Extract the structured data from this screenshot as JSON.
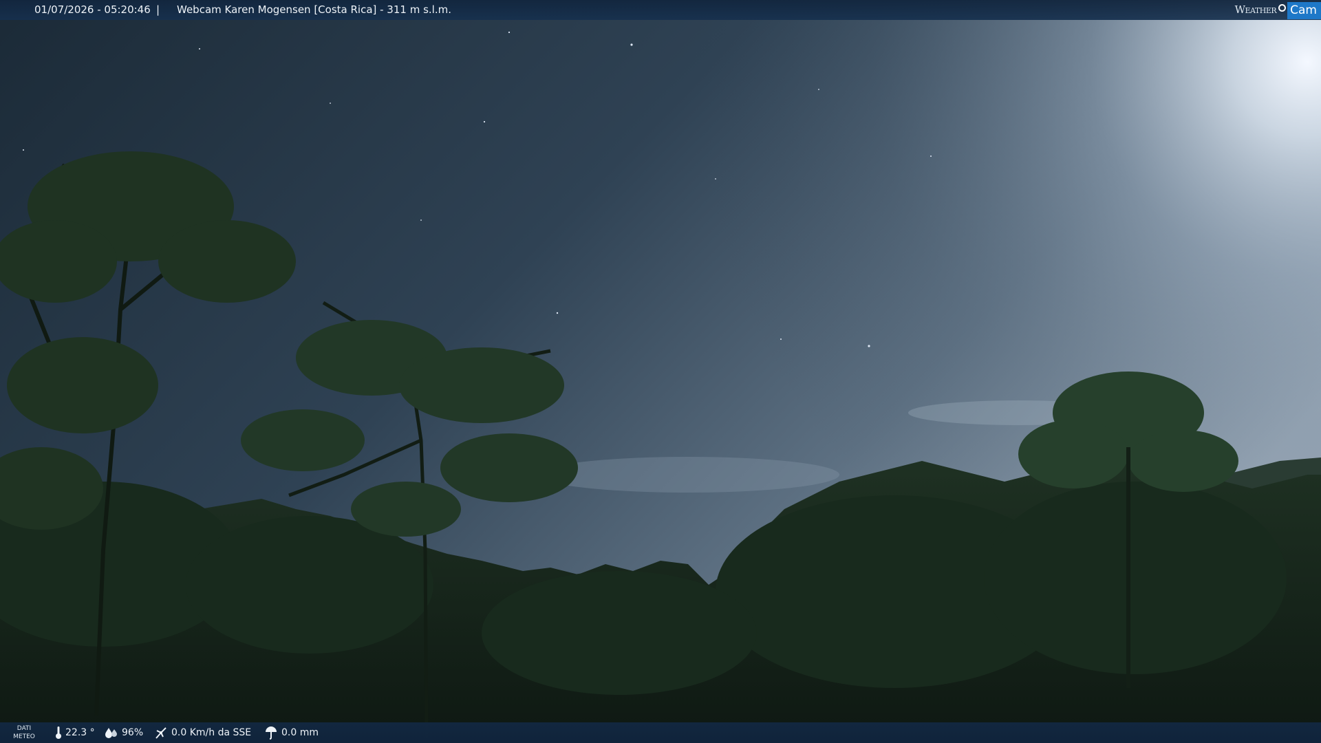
{
  "header": {
    "datetime": "01/07/2026 - 05:20:46",
    "separator": "|",
    "camera_name": "Webcam Karen Mogensen [Costa Rica]  - 311 m s.l.m.",
    "logo_weather": "Weather",
    "logo_cam": "Cam"
  },
  "footer": {
    "dati_line1": "DATI",
    "dati_line2": "METEO",
    "temperature": "22.3 °",
    "humidity": "96%",
    "wind": "0.0 Km/h da SSE",
    "rain": "0.0 mm"
  },
  "icons": {
    "temperature": "thermometer-icon",
    "humidity": "humidity-icon",
    "wind": "wind-icon",
    "rain": "rain-gauge-icon"
  },
  "colors": {
    "bar_background": "#14304e",
    "logo_accent": "#1e78c8",
    "bar_text": "#eef3f8"
  }
}
